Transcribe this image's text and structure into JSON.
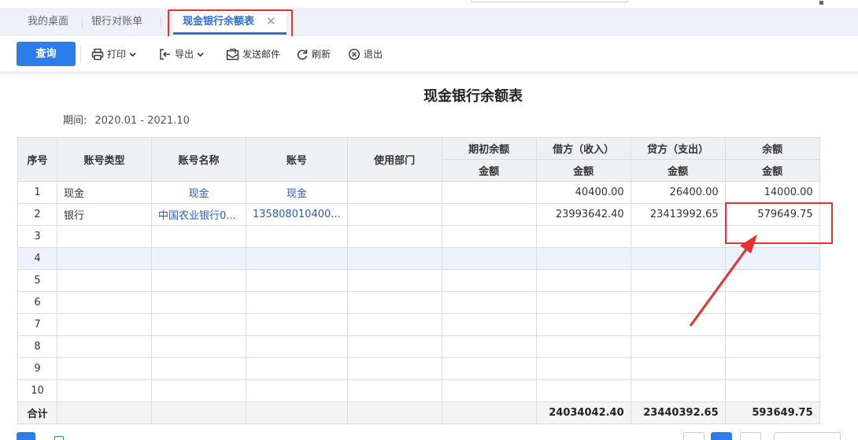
{
  "tabs": {
    "items": [
      {
        "label": "我的桌面"
      },
      {
        "label": "银行对账单"
      },
      {
        "label": "现金银行余额表",
        "active": true
      }
    ],
    "close_glyph": "✕"
  },
  "toolbar": {
    "query_label": "查询",
    "print_label": "打印",
    "export_label": "导出",
    "email_label": "发送邮件",
    "refresh_label": "刷新",
    "exit_label": "退出"
  },
  "report": {
    "title": "现金银行余额表",
    "period_label": "期间:",
    "period_value": "2020.01 - 2021.10"
  },
  "table": {
    "headers": {
      "seq": "序号",
      "acct_type": "账号类型",
      "acct_name": "账号名称",
      "acct_no": "账号",
      "dept": "使用部门",
      "opening": "期初余额",
      "debit": "借方（收入）",
      "credit": "贷方（支出）",
      "balance": "余额",
      "amount": "金额"
    },
    "rows": [
      {
        "seq": "1",
        "type": "现金",
        "name": "现金",
        "no": "现金",
        "dept": "",
        "opening": "",
        "debit": "40400.00",
        "credit": "26400.00",
        "balance": "14000.00"
      },
      {
        "seq": "2",
        "type": "银行",
        "name": "中国农业银行0...",
        "no": "135808010400...",
        "dept": "",
        "opening": "",
        "debit": "23993642.40",
        "credit": "23413992.65",
        "balance": "579649.75"
      },
      {
        "seq": "3",
        "type": "",
        "name": "",
        "no": "",
        "dept": "",
        "opening": "",
        "debit": "",
        "credit": "",
        "balance": ""
      },
      {
        "seq": "4",
        "type": "",
        "name": "",
        "no": "",
        "dept": "",
        "opening": "",
        "debit": "",
        "credit": "",
        "balance": ""
      },
      {
        "seq": "5",
        "type": "",
        "name": "",
        "no": "",
        "dept": "",
        "opening": "",
        "debit": "",
        "credit": "",
        "balance": ""
      },
      {
        "seq": "6",
        "type": "",
        "name": "",
        "no": "",
        "dept": "",
        "opening": "",
        "debit": "",
        "credit": "",
        "balance": ""
      },
      {
        "seq": "7",
        "type": "",
        "name": "",
        "no": "",
        "dept": "",
        "opening": "",
        "debit": "",
        "credit": "",
        "balance": ""
      },
      {
        "seq": "8",
        "type": "",
        "name": "",
        "no": "",
        "dept": "",
        "opening": "",
        "debit": "",
        "credit": "",
        "balance": ""
      },
      {
        "seq": "9",
        "type": "",
        "name": "",
        "no": "",
        "dept": "",
        "opening": "",
        "debit": "",
        "credit": "",
        "balance": ""
      },
      {
        "seq": "10",
        "type": "",
        "name": "",
        "no": "",
        "dept": "",
        "opening": "",
        "debit": "",
        "credit": "",
        "balance": ""
      }
    ],
    "total": {
      "label": "合计",
      "debit": "24034042.40",
      "credit": "23440392.65",
      "balance": "593649.75"
    }
  },
  "colors": {
    "accent": "#2b7de9",
    "link": "#2b58c9",
    "annotation": "#e8312f"
  }
}
